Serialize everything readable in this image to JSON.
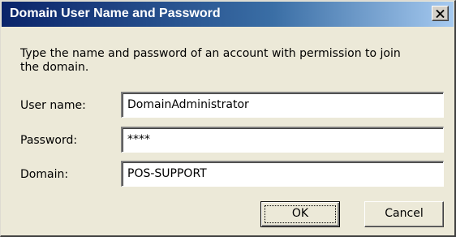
{
  "dialog": {
    "title": "Domain User Name and Password",
    "close_icon": "close-icon",
    "instructions": "Type the name and password of an account with permission to join the domain.",
    "fields": {
      "username": {
        "label": "User name:",
        "value": "DomainAdministrator"
      },
      "password": {
        "label": "Password:",
        "value": "****"
      },
      "domain": {
        "label": "Domain:",
        "value": "POS-SUPPORT"
      }
    },
    "buttons": {
      "ok": "OK",
      "cancel": "Cancel"
    }
  },
  "colors": {
    "titlebar_start": "#0a246a",
    "titlebar_end": "#a6caf0",
    "face": "#ece9d8"
  }
}
